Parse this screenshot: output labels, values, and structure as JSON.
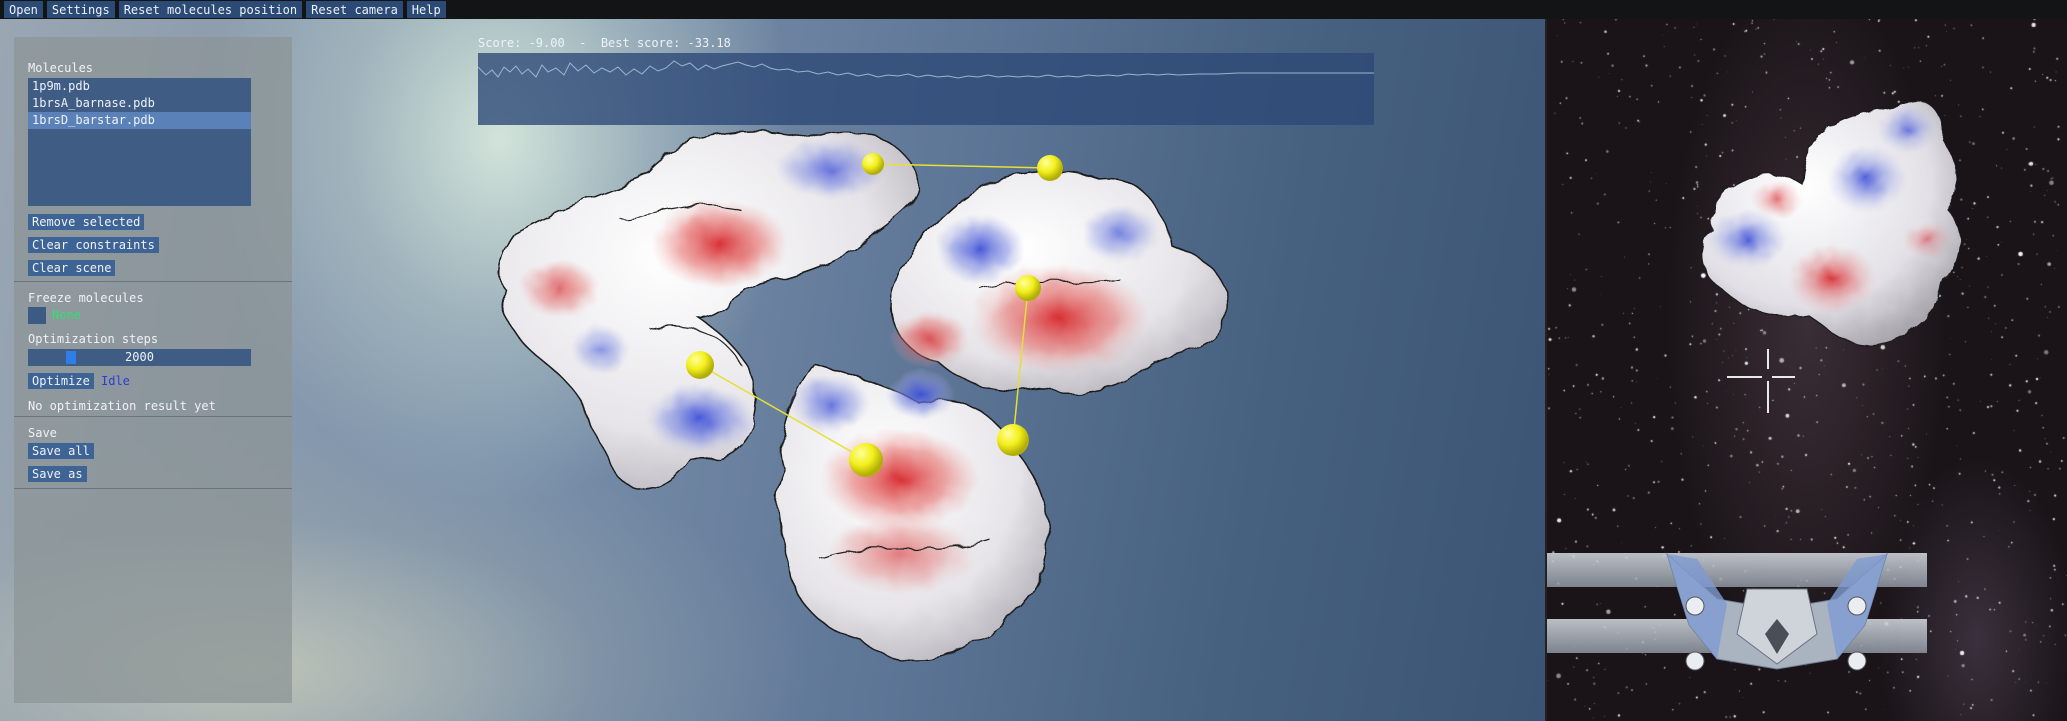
{
  "menu": {
    "items": [
      "Open",
      "Settings",
      "Reset molecules position",
      "Reset camera",
      "Help"
    ]
  },
  "panel": {
    "molecules_label": "Molecules",
    "molecules": [
      "1p9m.pdb",
      "1brsA_barnase.pdb",
      "1brsD_barstar.pdb"
    ],
    "selected_molecule": "1brsD_barstar.pdb",
    "remove_selected": "Remove selected",
    "clear_constraints": "Clear constraints",
    "clear_scene": "Clear scene",
    "freeze_label": "Freeze molecules",
    "freeze_caption": "None",
    "freeze_checked": false,
    "opt_steps_label": "Optimization steps",
    "opt_steps_value": "2000",
    "opt_steps_fraction": 0.18,
    "optimize_button": "Optimize",
    "status": "Idle",
    "result_text": "No optimization result yet",
    "save_label": "Save",
    "save_all": "Save all",
    "save_as": "Save as"
  },
  "score": {
    "text": "Score: -9.00  -  Best score: -33.18",
    "current": -9.0,
    "best": -33.18
  },
  "colors": {
    "menu_button": "#2b4a75",
    "list_background": "#3f5c84",
    "list_selected": "#5b82b8",
    "button": "#3e6395",
    "slider_thumb": "#2d7ee6",
    "status_idle": "#2b3dd6",
    "freeze_caption": "#2fe26e",
    "constraint_marker": "#f2ee1a",
    "surface_negative": "#d92a2a",
    "surface_positive": "#4a5cd6",
    "surface_neutral": "#f2f2f2"
  },
  "icons": {
    "constraint_marker": "constraint-marker-icon",
    "spaceship": "spaceship-icon",
    "crosshair": "crosshair-icon"
  }
}
